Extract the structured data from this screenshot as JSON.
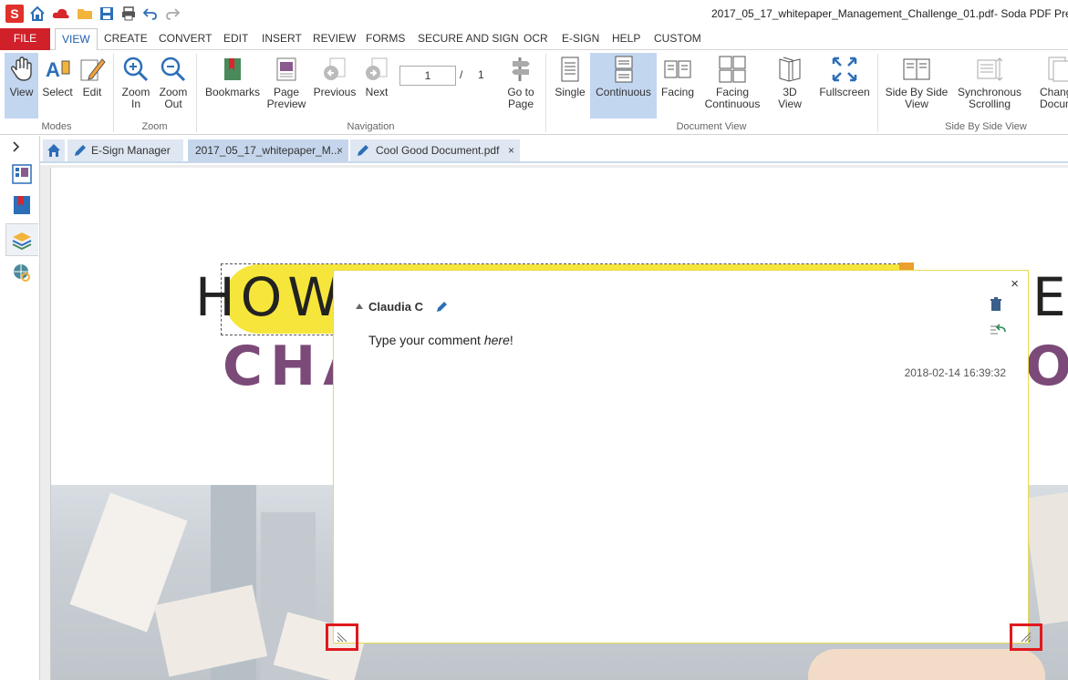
{
  "titlebar": {
    "logo": "S",
    "title": "2017_05_17_whitepaper_Management_Challenge_01.pdf",
    "app": "-     Soda PDF Premium"
  },
  "menu": {
    "file": "FILE",
    "tabs": [
      "VIEW",
      "CREATE",
      "CONVERT",
      "EDIT",
      "INSERT",
      "REVIEW",
      "FORMS",
      "SECURE AND SIGN",
      "OCR",
      "E-SIGN",
      "HELP",
      "CUSTOM"
    ]
  },
  "ribbon": {
    "view": "View",
    "select": "Select",
    "edit": "Edit",
    "zoom_in": "Zoom\nIn",
    "zoom_out": "Zoom\nOut",
    "bookmarks": "Bookmarks",
    "page_preview": "Page\nPreview",
    "previous": "Previous",
    "next": "Next",
    "page_current": "1",
    "page_sep": "/",
    "page_total": "1",
    "go_to_page": "Go to\nPage",
    "single": "Single",
    "continuous": "Continuous",
    "facing": "Facing",
    "facing_continuous": "Facing\nContinuous",
    "three_d_view": "3D\nView",
    "fullscreen": "Fullscreen",
    "side_by_side_view": "Side By Side\nView",
    "synchronous_scrolling": "Synchronous\nScrolling",
    "change_document": "Change\nDocument",
    "groups": {
      "modes": "Modes",
      "zoom": "Zoom",
      "navigation": "Navigation",
      "document_view": "Document View",
      "side_by_side": "Side By Side View"
    }
  },
  "doctabs": {
    "esign": "E-Sign Manager",
    "doc1": "2017_05_17_whitepaper_M...",
    "doc2": "Cool Good Document.pdf",
    "close": "×"
  },
  "document": {
    "headline1": "HOW",
    "headline1_right": "EN",
    "headline2": "CHA",
    "headline2_right": "O"
  },
  "comment": {
    "author": "Claudia C",
    "text_before": "Type your comment ",
    "text_em": "here",
    "text_after": "!",
    "date": "2018-02-14 16:39:32",
    "close": "×"
  },
  "colors": {
    "file_tab": "#d0202a",
    "accent_blue": "#1d5ea8",
    "ribbon_selected": "#c3d6f0",
    "highlight_yellow": "#f6e63b",
    "headline_purple": "#7b4a78",
    "resize_handle_box": "#e0191e"
  }
}
